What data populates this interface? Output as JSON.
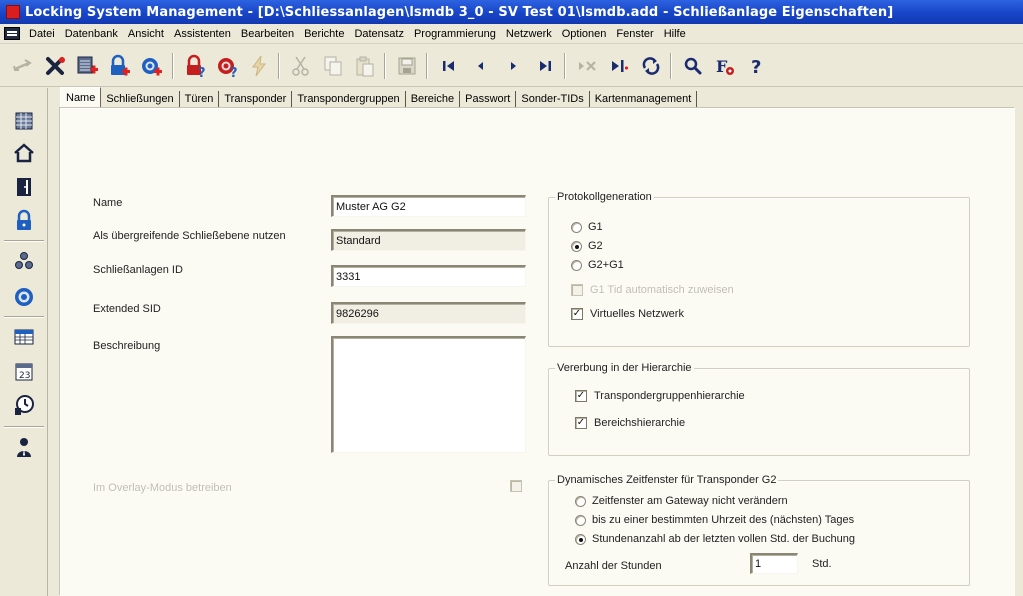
{
  "window": {
    "title": "Locking System Management - [D:\\Schliessanlagen\\lsmdb 3_0 - SV Test 01\\lsmdb.add - Schließanlage Eigenschaften]"
  },
  "menu": [
    "Datei",
    "Datenbank",
    "Ansicht",
    "Assistenten",
    "Bearbeiten",
    "Berichte",
    "Datensatz",
    "Programmierung",
    "Netzwerk",
    "Optionen",
    "Fenster",
    "Hilfe"
  ],
  "toolbar": {
    "icons": [
      "swap-arrows-icon",
      "delete-x-icon",
      "new-system-icon",
      "new-lock-icon",
      "new-transponder-icon",
      "lock-question-icon",
      "transponder-question-icon",
      "lightning-icon",
      "cut-icon",
      "copy-icon",
      "paste-icon",
      "save-icon",
      "first-record-icon",
      "previous-record-icon",
      "next-record-icon",
      "last-record-icon",
      "delete-record-icon",
      "new-record-icon",
      "refresh-icon",
      "search-icon",
      "filter-icon",
      "help-icon"
    ]
  },
  "sidebar": {
    "icons": [
      "grid-icon",
      "home-icon",
      "door-icon",
      "lock-icon",
      "group-icon",
      "transponder-icon",
      "table-icon",
      "calendar-icon",
      "clock-icon",
      "person-icon"
    ],
    "calendar_day": "23"
  },
  "tabs": [
    "Name",
    "Schließungen",
    "Türen",
    "Transponder",
    "Transpondergruppen",
    "Bereiche",
    "Passwort",
    "Sonder-TIDs",
    "Kartenmanagement"
  ],
  "form": {
    "name_label": "Name",
    "name_value": "Muster AG G2",
    "level_label": "Als übergreifende Schließebene nutzen",
    "level_value": "Standard",
    "id_label": "Schließanlagen ID",
    "id_value": "3331",
    "sid_label": "Extended SID",
    "sid_value": "9826296",
    "desc_label": "Beschreibung",
    "desc_value": "",
    "overlay_label": "Im Overlay-Modus betreiben"
  },
  "protocol": {
    "legend": "Protokollgeneration",
    "g1": "G1",
    "g2": "G2",
    "g2g1": "G2+G1",
    "g1tid": "G1 Tid automatisch zuweisen",
    "virtual": "Virtuelles Netzwerk",
    "selected": "G2"
  },
  "inherit": {
    "legend": "Vererbung in der Hierarchie",
    "tgh": "Transpondergruppenhierarchie",
    "bh": "Bereichshierarchie"
  },
  "timewin": {
    "legend": "Dynamisches Zeitfenster für Transponder G2",
    "opt1": "Zeitfenster am Gateway nicht verändern",
    "opt2": "bis zu einer bestimmten Uhrzeit des (nächsten) Tages",
    "opt3": "Stundenanzahl ab der letzten vollen Std. der Buchung",
    "hours_label": "Anzahl der Stunden",
    "hours_value": "1",
    "hours_unit": "Std."
  },
  "colors": {
    "titlebar": "#1745c8",
    "accent_red": "#c41e1e",
    "accent_blue": "#1f5fbf"
  }
}
